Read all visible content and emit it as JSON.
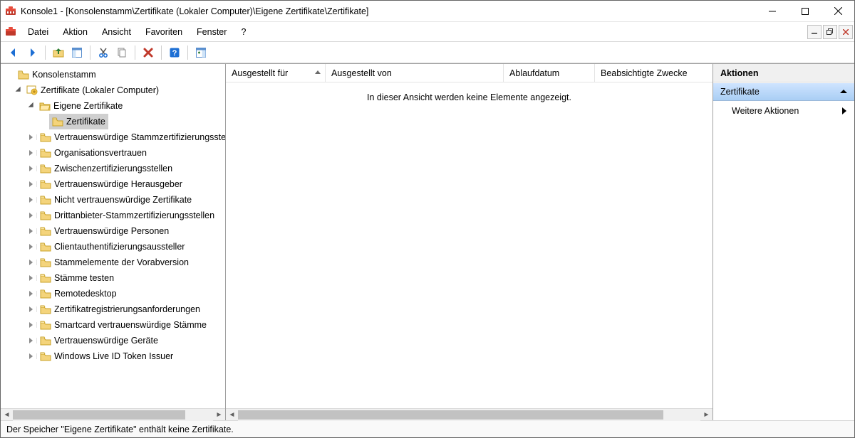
{
  "window": {
    "title": "Konsole1 - [Konsolenstamm\\Zertifikate (Lokaler Computer)\\Eigene Zertifikate\\Zertifikate]"
  },
  "menubar": {
    "items": [
      "Datei",
      "Aktion",
      "Ansicht",
      "Favoriten",
      "Fenster",
      "?"
    ]
  },
  "tree": {
    "root": "Konsolenstamm",
    "snapin": "Zertifikate (Lokaler Computer)",
    "personal": "Eigene Zertifikate",
    "selected": "Zertifikate",
    "children": [
      "Vertrauenswürdige Stammzertifizierungsstellen",
      "Organisationsvertrauen",
      "Zwischenzertifizierungsstellen",
      "Vertrauenswürdige Herausgeber",
      "Nicht vertrauenswürdige Zertifikate",
      "Drittanbieter-Stammzertifizierungsstellen",
      "Vertrauenswürdige Personen",
      "Clientauthentifizierungsaussteller",
      "Stammelemente der Vorabversion",
      "Stämme testen",
      "Remotedesktop",
      "Zertifikatregistrierungsanforderungen",
      "Smartcard vertrauenswürdige Stämme",
      "Vertrauenswürdige Geräte",
      "Windows Live ID Token Issuer"
    ]
  },
  "list": {
    "columns": [
      "Ausgestellt für",
      "Ausgestellt von",
      "Ablaufdatum",
      "Beabsichtigte Zwecke"
    ],
    "empty_message": "In dieser Ansicht werden keine Elemente angezeigt."
  },
  "actions": {
    "header": "Aktionen",
    "section": "Zertifikate",
    "more": "Weitere Aktionen"
  },
  "statusbar": {
    "text": "Der Speicher \"Eigene Zertifikate\" enthält keine Zertifikate."
  }
}
